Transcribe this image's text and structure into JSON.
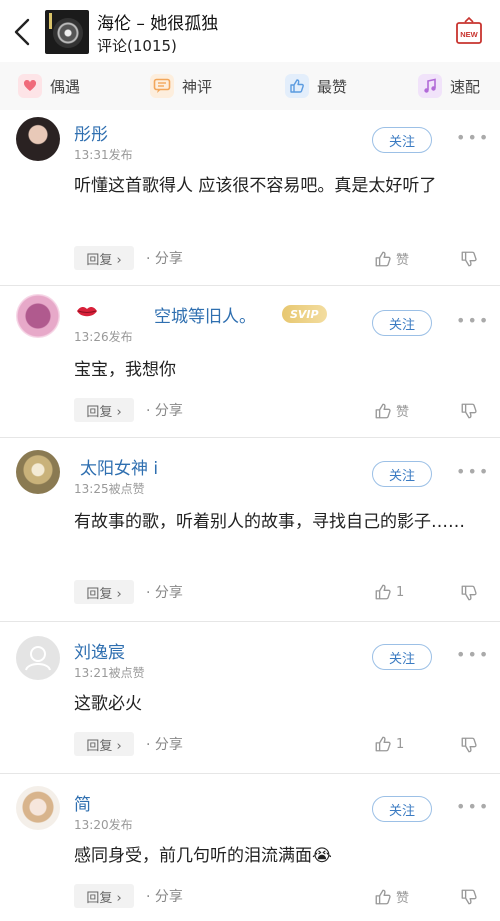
{
  "header": {
    "song_title": "海伦 – 她很孤独",
    "comment_count": "评论(1015)",
    "new_label": "NEW"
  },
  "tabs": [
    {
      "label": "偶遇",
      "icon": "heart-chat-icon",
      "color": "#f06a7a"
    },
    {
      "label": "神评",
      "icon": "chat-bubble-icon",
      "color": "#f2a65a"
    },
    {
      "label": "最赞",
      "icon": "thumbs-up-icon",
      "color": "#5b9be0"
    },
    {
      "label": "速配",
      "icon": "music-note-icon",
      "color": "#b26ad8"
    }
  ],
  "comments": [
    {
      "user": "彤彤",
      "meta": "13:31发布",
      "text": "听懂这首歌得人 应该很不容易吧。真是太好听了",
      "likes": "赞",
      "follow": "关注",
      "reply": "回复 ›",
      "share": "分享"
    },
    {
      "user": "空城等旧人。",
      "meta": "13:26发布",
      "text": "宝宝，我想你",
      "likes": "赞",
      "follow": "关注",
      "reply": "回复 ›",
      "share": "分享",
      "badge": "SVIP"
    },
    {
      "user": "太阳女神 i",
      "meta": "13:25被点赞",
      "text": "有故事的歌，听着别人的故事，寻找自己的影子……",
      "likes": "1",
      "follow": "关注",
      "reply": "回复 ›",
      "share": "分享"
    },
    {
      "user": "刘逸宸",
      "meta": "13:21被点赞",
      "text": "这歌必火",
      "likes": "1",
      "follow": "关注",
      "reply": "回复 ›",
      "share": "分享"
    },
    {
      "user": "简",
      "meta": "13:20发布",
      "text": "感同身受，前几句听的泪流满面😭",
      "likes": "赞",
      "follow": "关注",
      "reply": "回复 ›",
      "share": "分享"
    }
  ],
  "colors": {
    "link": "#2f6fb0",
    "follow_border": "#9cc0e6",
    "divider": "#e6e6e6"
  }
}
